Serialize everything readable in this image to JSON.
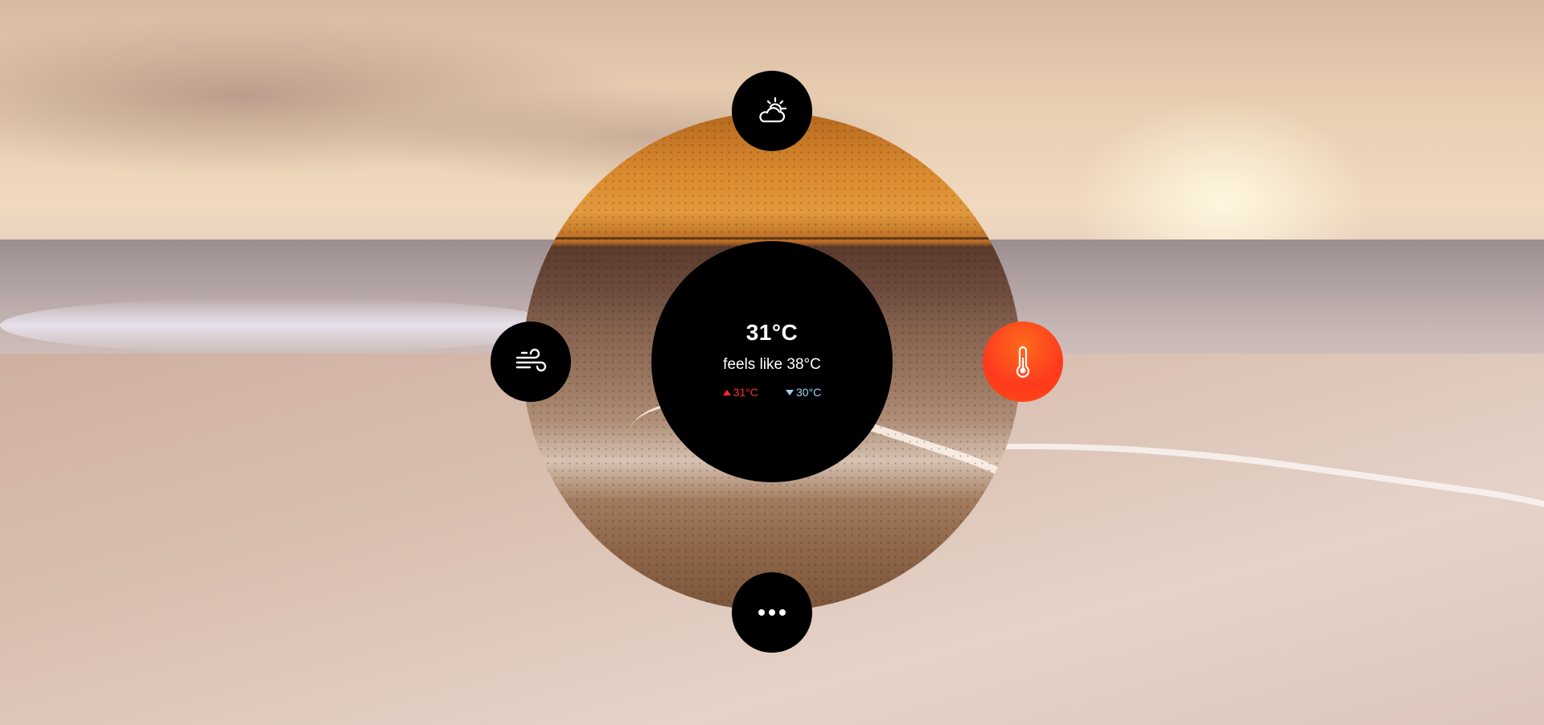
{
  "weather": {
    "temperature": "31°C",
    "feels_like": "feels like 38°C",
    "high": "31°C",
    "low": "30°C"
  },
  "controls": {
    "top": {
      "icon": "partly-sunny-icon"
    },
    "left": {
      "icon": "wind-icon"
    },
    "right": {
      "icon": "thermometer-icon",
      "active": true
    },
    "bottom": {
      "icon": "more-dots-icon"
    }
  },
  "colors": {
    "core_background": "#000000",
    "active_button_gradient": [
      "#ff6a1c",
      "#ff3a1e"
    ],
    "high_temp": "#ff2a2a",
    "low_temp": "#9ad2f5"
  }
}
